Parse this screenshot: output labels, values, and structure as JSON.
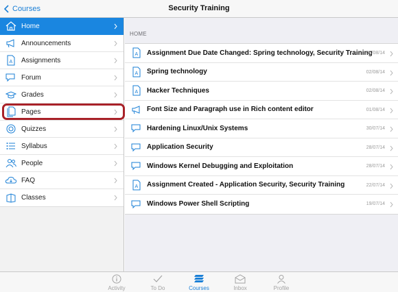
{
  "navbar": {
    "back_label": "Courses",
    "title": "Security Training"
  },
  "sidebar": {
    "items": [
      {
        "label": "Home",
        "icon": "home-icon",
        "active": true
      },
      {
        "label": "Announcements",
        "icon": "megaphone-icon"
      },
      {
        "label": "Assignments",
        "icon": "assignment-doc-icon"
      },
      {
        "label": "Forum",
        "icon": "discussion-icon"
      },
      {
        "label": "Grades",
        "icon": "grades-icon"
      },
      {
        "label": "Pages",
        "icon": "pages-icon"
      },
      {
        "label": "Quizzes",
        "icon": "quiz-icon"
      },
      {
        "label": "Syllabus",
        "icon": "syllabus-icon"
      },
      {
        "label": "People",
        "icon": "people-icon"
      },
      {
        "label": "FAQ",
        "icon": "cloud-icon"
      },
      {
        "label": "Classes",
        "icon": "classes-icon"
      }
    ]
  },
  "main": {
    "section_header": "HOME",
    "rows": [
      {
        "title": "Assignment Due Date Changed: Spring technology, Security Training",
        "date": "06/08/14",
        "icon": "assignment-doc-icon"
      },
      {
        "title": "Spring technology",
        "date": "02/08/14",
        "icon": "assignment-doc-icon"
      },
      {
        "title": "Hacker Techniques",
        "date": "02/08/14",
        "icon": "assignment-doc-icon"
      },
      {
        "title": "Font Size and Paragraph use in Rich content editor",
        "date": "01/08/14",
        "icon": "megaphone-icon"
      },
      {
        "title": "Hardening Linux/Unix Systems",
        "date": "30/07/14",
        "icon": "discussion-icon"
      },
      {
        "title": "Application Security",
        "date": "28/07/14",
        "icon": "discussion-icon"
      },
      {
        "title": "Windows Kernel Debugging and Exploitation",
        "date": "28/07/14",
        "icon": "discussion-icon"
      },
      {
        "title": "Assignment Created - Application Security, Security Training",
        "date": "22/07/14",
        "icon": "assignment-doc-icon"
      },
      {
        "title": "Windows Power Shell Scripting",
        "date": "19/07/14",
        "icon": "discussion-icon"
      }
    ]
  },
  "tabbar": {
    "tabs": [
      {
        "label": "Activity",
        "icon": "info-icon"
      },
      {
        "label": "To Do",
        "icon": "checkmark-icon"
      },
      {
        "label": "Courses",
        "icon": "courses-stack-icon",
        "active": true
      },
      {
        "label": "Inbox",
        "icon": "inbox-icon"
      },
      {
        "label": "Profile",
        "icon": "profile-icon"
      }
    ]
  },
  "colors": {
    "accent": "#1a86e0",
    "highlight_outline": "#a82128",
    "link": "#1a7fd6"
  }
}
